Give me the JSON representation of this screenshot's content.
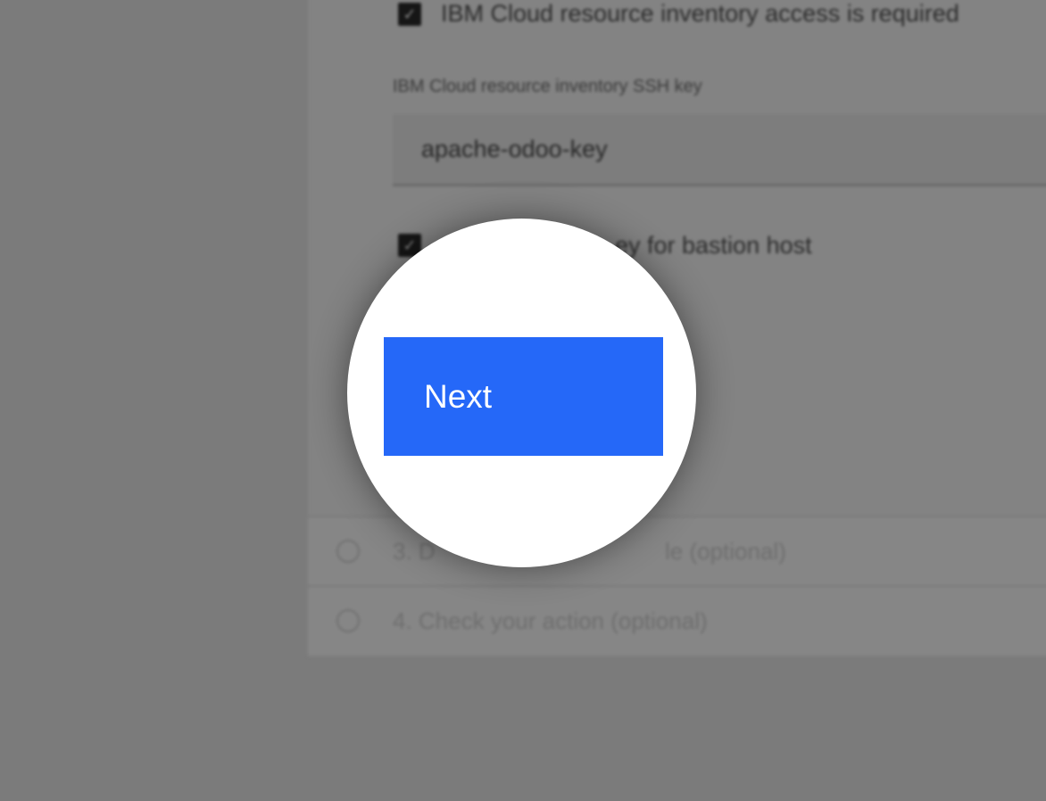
{
  "background": {
    "inventory_access_checkbox": {
      "label": "IBM Cloud resource inventory access is required",
      "checked": true,
      "check_glyph": "✓"
    },
    "ssh_key_field": {
      "label": "IBM Cloud resource inventory SSH key",
      "value": "apache-odoo-key"
    },
    "bastion_checkbox": {
      "label_visible_fragment": "ey for bastion host",
      "checked": true,
      "check_glyph": "✓"
    },
    "steps": [
      {
        "label_visible_fragment": "3. D",
        "label_tail_fragment": "le (optional)"
      },
      {
        "label": "4. Check your action (optional)"
      }
    ]
  },
  "spotlight": {
    "next_button": {
      "label": "Next"
    }
  },
  "colors": {
    "overlay": "#7b7b7b",
    "primary_button": "#2568f8",
    "spotlight": "#ffffff"
  }
}
